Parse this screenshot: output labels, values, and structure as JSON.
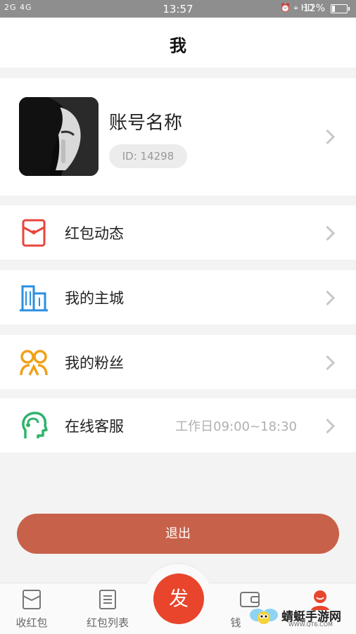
{
  "status_bar": {
    "signal_text": "2G 4G",
    "time": "13:57",
    "icons_right": "⏰ ⌖ HD",
    "battery": "12%"
  },
  "header": {
    "title": "我"
  },
  "profile": {
    "account_name": "账号名称",
    "id_text": "ID: 14298"
  },
  "menu": [
    {
      "label": "红包动态",
      "sub": "",
      "icon": "red-envelope-icon",
      "color": "#e8453c"
    },
    {
      "label": "我的主城",
      "sub": "",
      "icon": "city-buildings-icon",
      "color": "#2b8fe0"
    },
    {
      "label": "我的粉丝",
      "sub": "",
      "icon": "fans-icon",
      "color": "#f0a019"
    },
    {
      "label": "在线客服",
      "sub": "工作日09:00~18:30",
      "icon": "headset-service-icon",
      "color": "#2eb36b"
    }
  ],
  "logout_label": "退出",
  "tabbar": {
    "tab1": "收红包",
    "tab2": "红包列表",
    "fab": "发",
    "tab4": "钱",
    "tab5": ""
  },
  "watermark": {
    "main": "蜻蜓手游网",
    "sub": "WWW.QT6.COM"
  },
  "colors": {
    "accent": "#c8614a",
    "fab": "#e8452c"
  }
}
